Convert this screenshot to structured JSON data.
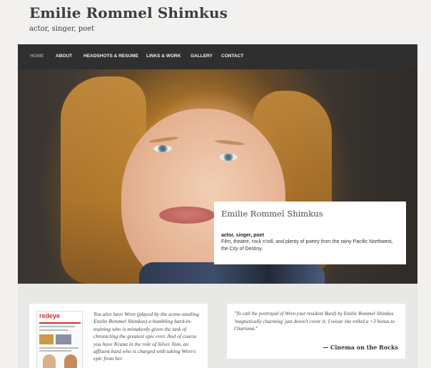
{
  "site": {
    "title": "Emilie Rommel Shimkus",
    "tagline": "actor, singer, poet"
  },
  "nav": {
    "items": [
      {
        "label": "HOME",
        "active": true
      },
      {
        "label": "ABOUT"
      },
      {
        "label": "HEADSHOTS & RESUME"
      },
      {
        "label": "LINKS & WORK"
      },
      {
        "label": "GALLERY"
      },
      {
        "label": "CONTACT"
      }
    ]
  },
  "hero": {
    "image": "portrait-photo",
    "card": {
      "title": "Emilie Rommel Shimkus",
      "subtitle": "actor, singer, poet",
      "description": "Film, theatre, rock n'roll, and plenty of poetry from the rainy Pacific Northwest, the City of Destiny."
    }
  },
  "widgets": {
    "press": {
      "thumbnail_masthead": "redeye",
      "text": "You also have Wren (played by the scene-stealing Emilie Rommel Shimkus) a bumbling bard-in-training who is mistakenly given the task of chronicling the greatest epic ever. And of course you have Krana in the role of Silver Tom, an affluent bard who is charged with taking Wren's epic from her."
    },
    "quote": {
      "text": "\"To call the portrayal of Wren (our resident Bard) by Emilie Rommel Shimkus 'magnetically charming' just doesn't cover it; I swear she rolled a +3 bonus to Charisma.\"",
      "source": "— Cinema on the Rocks"
    }
  },
  "colors": {
    "nav_bg": "#2f2f2f",
    "page_bg": "#f2f1ef",
    "band_bg": "#e8e8e6",
    "accent_red": "#d22a2a"
  }
}
